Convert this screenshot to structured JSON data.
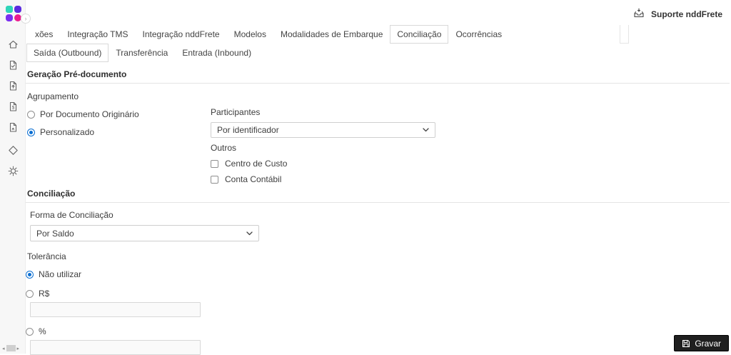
{
  "app": {
    "support_label": "Suporte nddFrete"
  },
  "colors": {
    "accent_blue": "#0a6ed1",
    "button_dark": "#1f1f1f",
    "sidebar_bg": "#f7f7f7",
    "border_light": "#d9d9d9",
    "logo_teal": "#2fd5b9",
    "logo_indigo": "#5b2be0",
    "logo_purple": "#7a2ff0",
    "logo_pink": "#ec1c8d"
  },
  "sidebar": {
    "expand_glyph": "›",
    "scrollbar": {
      "left_glyph": "◂",
      "right_glyph": "▸"
    }
  },
  "tabs": {
    "items": [
      {
        "label": "xões",
        "active": false
      },
      {
        "label": "Integração TMS",
        "active": false
      },
      {
        "label": "Integração nddFrete",
        "active": false
      },
      {
        "label": "Modelos",
        "active": false
      },
      {
        "label": "Modalidades de Embarque",
        "active": false
      },
      {
        "label": "Conciliação",
        "active": true
      },
      {
        "label": "Ocorrências",
        "active": false
      }
    ]
  },
  "subtabs": {
    "items": [
      {
        "label": "Saída (Outbound)",
        "active": true
      },
      {
        "label": "Transferência",
        "active": false
      },
      {
        "label": "Entrada (Inbound)",
        "active": false
      }
    ]
  },
  "pre_document": {
    "title": "Geração Pré-documento",
    "agrupamento": {
      "label": "Agrupamento",
      "options": [
        {
          "label": "Por Documento Originário",
          "checked": false
        },
        {
          "label": "Personalizado",
          "checked": true
        }
      ]
    },
    "participantes": {
      "label": "Participantes",
      "value": "Por identificador"
    },
    "outros": {
      "label": "Outros",
      "options": [
        {
          "label": "Centro de Custo",
          "checked": false
        },
        {
          "label": "Conta Contábil",
          "checked": false
        }
      ]
    }
  },
  "conciliacao": {
    "title": "Conciliação",
    "forma": {
      "label": "Forma de Conciliação",
      "value": "Por Saldo"
    },
    "tolerancia": {
      "label": "Tolerância",
      "options": [
        {
          "label": "Não utilizar",
          "checked": true
        },
        {
          "label": "R$",
          "checked": false,
          "value": ""
        },
        {
          "label": "%",
          "checked": false,
          "value": ""
        }
      ]
    }
  },
  "footer": {
    "save_label": "Gravar"
  }
}
